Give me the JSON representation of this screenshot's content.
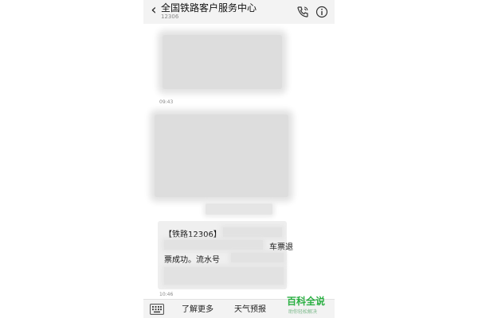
{
  "header": {
    "title": "全国铁路客户服务中心",
    "subtitle": "12306",
    "back_icon": "chevron-left-icon",
    "call_icon": "phone-icon",
    "info_icon": "info-icon"
  },
  "messages": {
    "time_1": "09:43",
    "sms_line_1": "【铁路12306】",
    "sms_line_2": "车票退",
    "sms_line_3": "票成功。流水号",
    "time_2": "10:46"
  },
  "bottom_bar": {
    "keyboard_icon": "keyboard-icon",
    "menu_1": "了解更多",
    "menu_2": "天气预报"
  },
  "watermark": {
    "logo": "百科全说",
    "tagline": "助你轻松解决"
  },
  "colors": {
    "header_bg": "#f3f3f3",
    "bubble_bg": "#efefef",
    "watermark_green": "#2bb043"
  }
}
